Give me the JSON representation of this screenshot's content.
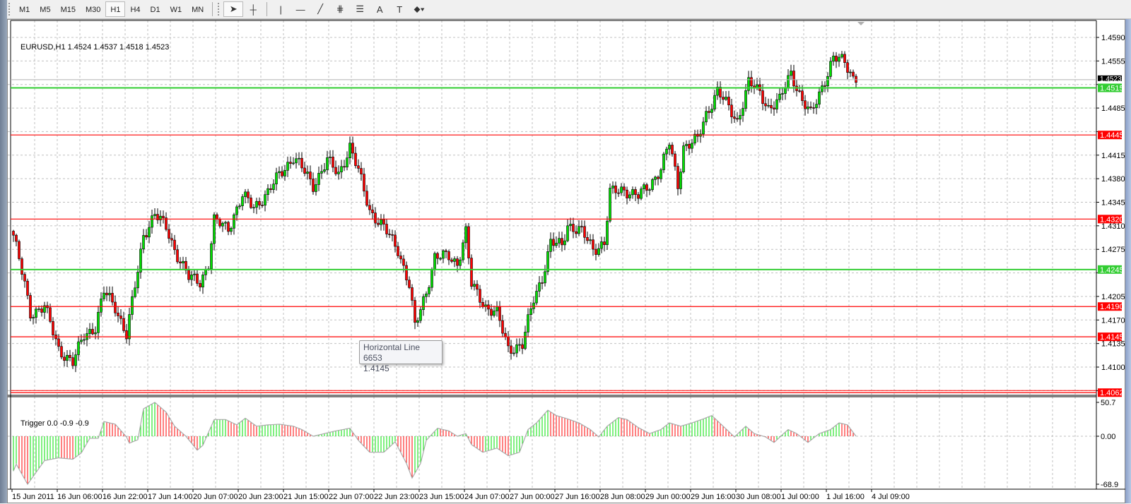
{
  "toolbar": {
    "timeframes": [
      "M1",
      "M5",
      "M15",
      "M30",
      "H1",
      "H4",
      "D1",
      "W1",
      "MN"
    ],
    "active_timeframe": "H1",
    "tools": [
      {
        "name": "cursor-icon",
        "glyph": "➤"
      },
      {
        "name": "crosshair-icon",
        "glyph": "┼"
      },
      {
        "name": "vertical-line-icon",
        "glyph": "|"
      },
      {
        "name": "horizontal-line-icon",
        "glyph": "—"
      },
      {
        "name": "trendline-icon",
        "glyph": "╱"
      },
      {
        "name": "fibo-fan-icon",
        "glyph": "⋕"
      },
      {
        "name": "fibo-retracement-icon",
        "glyph": "☰"
      },
      {
        "name": "text-icon",
        "glyph": "A"
      },
      {
        "name": "text-label-icon",
        "glyph": "T"
      },
      {
        "name": "arrows-dropdown-icon",
        "glyph": "⬥▾"
      }
    ]
  },
  "chart": {
    "symbol_line": "EURUSD,H1  1.4524 1.4537 1.4518 1.4523",
    "indicator_line": "Trigger 0.0 -0.9 -0.9",
    "tooltip_title": "Horizontal Line 6653",
    "tooltip_value": "1.4145",
    "colors": {
      "bull": "#00e000",
      "bear": "#ff0000",
      "green_line": "#32cd32",
      "red_line": "#ff0000",
      "grid": "#c0c0c0"
    }
  },
  "chart_data": {
    "type": "candlestick",
    "symbol": "EURUSD",
    "timeframe": "H1",
    "price_axis": {
      "ticks": [
        "1.4590",
        "1.4555",
        "1.4485",
        "1.4415",
        "1.4380",
        "1.4345",
        "1.4310",
        "1.4275",
        "1.4205",
        "1.4170",
        "1.4135",
        "1.4100"
      ],
      "range": [
        1.4058,
        1.4612
      ]
    },
    "current_price": "1.4523",
    "horizontal_lines": [
      {
        "price": "1.4515",
        "color": "green"
      },
      {
        "price": "1.4445",
        "color": "red"
      },
      {
        "price": "1.4320",
        "color": "red"
      },
      {
        "price": "1.4245",
        "color": "green"
      },
      {
        "price": "1.4190",
        "color": "red"
      },
      {
        "price": "1.4145",
        "color": "red"
      },
      {
        "price": "1.4062",
        "color": "red"
      }
    ],
    "time_labels": [
      "15 Jun 2011",
      "16 Jun 06:00",
      "16 Jun 22:00",
      "17 Jun 14:00",
      "20 Jun 07:00",
      "20 Jun 23:00",
      "21 Jun 15:00",
      "22 Jun 07:00",
      "22 Jun 23:00",
      "23 Jun 15:00",
      "24 Jun 07:00",
      "27 Jun 00:00",
      "27 Jun 16:00",
      "28 Jun 08:00",
      "29 Jun 00:00",
      "29 Jun 16:00",
      "30 Jun 08:00",
      "1 Jul 00:00",
      "1 Jul 16:00",
      "4 Jul 09:00"
    ],
    "close_keypoints_bar_price": [
      [
        0,
        1.4296
      ],
      [
        4,
        1.4222
      ],
      [
        6,
        1.418
      ],
      [
        11,
        1.419
      ],
      [
        16,
        1.4127
      ],
      [
        21,
        1.4106
      ],
      [
        25,
        1.4148
      ],
      [
        29,
        1.4159
      ],
      [
        32,
        1.4212
      ],
      [
        36,
        1.419
      ],
      [
        40,
        1.4148
      ],
      [
        44,
        1.4243
      ],
      [
        46,
        1.4296
      ],
      [
        50,
        1.4328
      ],
      [
        54,
        1.4307
      ],
      [
        57,
        1.4275
      ],
      [
        62,
        1.4233
      ],
      [
        66,
        1.4227
      ],
      [
        69,
        1.4254
      ],
      [
        71,
        1.4317
      ],
      [
        76,
        1.4307
      ],
      [
        81,
        1.4354
      ],
      [
        85,
        1.4338
      ],
      [
        90,
        1.4359
      ],
      [
        94,
        1.4386
      ],
      [
        99,
        1.4412
      ],
      [
        102,
        1.4396
      ],
      [
        106,
        1.437
      ],
      [
        111,
        1.4407
      ],
      [
        115,
        1.4386
      ],
      [
        119,
        1.4428
      ],
      [
        122,
        1.4391
      ],
      [
        126,
        1.4333
      ],
      [
        131,
        1.4307
      ],
      [
        136,
        1.4275
      ],
      [
        140,
        1.4222
      ],
      [
        142,
        1.4159
      ],
      [
        146,
        1.4212
      ],
      [
        149,
        1.4264
      ],
      [
        154,
        1.4264
      ],
      [
        157,
        1.4254
      ],
      [
        160,
        1.4301
      ],
      [
        162,
        1.4222
      ],
      [
        167,
        1.419
      ],
      [
        171,
        1.418
      ],
      [
        175,
        1.4127
      ],
      [
        180,
        1.4133
      ],
      [
        184,
        1.4201
      ],
      [
        187,
        1.4233
      ],
      [
        190,
        1.4285
      ],
      [
        194,
        1.428
      ],
      [
        196,
        1.4312
      ],
      [
        201,
        1.4301
      ],
      [
        205,
        1.4275
      ],
      [
        209,
        1.4285
      ],
      [
        211,
        1.4359
      ],
      [
        216,
        1.4364
      ],
      [
        221,
        1.4354
      ],
      [
        225,
        1.437
      ],
      [
        229,
        1.4396
      ],
      [
        232,
        1.4433
      ],
      [
        235,
        1.437
      ],
      [
        237,
        1.4428
      ],
      [
        242,
        1.4438
      ],
      [
        245,
        1.4475
      ],
      [
        249,
        1.4512
      ],
      [
        252,
        1.4491
      ],
      [
        256,
        1.4465
      ],
      [
        260,
        1.4523
      ],
      [
        264,
        1.4507
      ],
      [
        267,
        1.4486
      ],
      [
        271,
        1.4496
      ],
      [
        275,
        1.4538
      ],
      [
        279,
        1.4496
      ],
      [
        282,
        1.4475
      ],
      [
        286,
        1.4517
      ],
      [
        290,
        1.4559
      ],
      [
        294,
        1.4554
      ],
      [
        298,
        1.4523
      ]
    ],
    "indicator": {
      "name": "Trigger",
      "axis_labels": [
        "50.7",
        "0.00",
        "-68.9"
      ],
      "range": [
        -68.9,
        50.7
      ],
      "keypoints_bar_value": [
        [
          0,
          -50
        ],
        [
          1,
          -40
        ],
        [
          5,
          -68.9
        ],
        [
          11,
          -35
        ],
        [
          16,
          -31
        ],
        [
          21,
          -33
        ],
        [
          24,
          -24
        ],
        [
          27,
          -3
        ],
        [
          30,
          -3
        ],
        [
          32,
          22
        ],
        [
          36,
          18
        ],
        [
          40,
          -1
        ],
        [
          41,
          -10
        ],
        [
          44,
          -5
        ],
        [
          46,
          41
        ],
        [
          50,
          50.7
        ],
        [
          54,
          36
        ],
        [
          57,
          15
        ],
        [
          61,
          0
        ],
        [
          65,
          -20
        ],
        [
          67,
          -13
        ],
        [
          71,
          25
        ],
        [
          75,
          25
        ],
        [
          79,
          17
        ],
        [
          82,
          27
        ],
        [
          86,
          15
        ],
        [
          90,
          17
        ],
        [
          94,
          18
        ],
        [
          99,
          15
        ],
        [
          102,
          10
        ],
        [
          106,
          0
        ],
        [
          110,
          4
        ],
        [
          114,
          8
        ],
        [
          119,
          12
        ],
        [
          122,
          -6
        ],
        [
          126,
          -23
        ],
        [
          131,
          -23
        ],
        [
          135,
          -8
        ],
        [
          139,
          -39
        ],
        [
          141,
          -60
        ],
        [
          144,
          -39
        ],
        [
          146,
          -6
        ],
        [
          150,
          12
        ],
        [
          154,
          8
        ],
        [
          157,
          0
        ],
        [
          160,
          4
        ],
        [
          162,
          -12
        ],
        [
          166,
          -23
        ],
        [
          171,
          -17
        ],
        [
          175,
          -28
        ],
        [
          179,
          -23
        ],
        [
          182,
          10
        ],
        [
          185,
          20
        ],
        [
          189,
          39
        ],
        [
          192,
          31
        ],
        [
          196,
          26
        ],
        [
          200,
          20
        ],
        [
          204,
          10
        ],
        [
          207,
          -1
        ],
        [
          210,
          15
        ],
        [
          214,
          28
        ],
        [
          217,
          25
        ],
        [
          221,
          13
        ],
        [
          225,
          4
        ],
        [
          229,
          10
        ],
        [
          232,
          20
        ],
        [
          236,
          15
        ],
        [
          240,
          20
        ],
        [
          244,
          26
        ],
        [
          247,
          31
        ],
        [
          251,
          15
        ],
        [
          255,
          -1
        ],
        [
          259,
          15
        ],
        [
          262,
          4
        ],
        [
          266,
          -1
        ],
        [
          269,
          -9
        ],
        [
          274,
          10
        ],
        [
          277,
          4
        ],
        [
          281,
          -9
        ],
        [
          285,
          4
        ],
        [
          289,
          10
        ],
        [
          292,
          20
        ],
        [
          295,
          17
        ],
        [
          298,
          0
        ]
      ]
    }
  }
}
